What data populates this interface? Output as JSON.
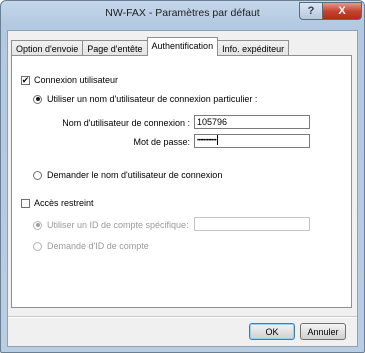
{
  "window": {
    "title": "NW-FAX - Paramètres par défaut"
  },
  "titlebar": {
    "help_glyph": "?",
    "close_glyph": "X"
  },
  "tabs": [
    {
      "label": "Option d'envoie",
      "active": false
    },
    {
      "label": "Page d'entête",
      "active": false
    },
    {
      "label": "Authentification",
      "active": true
    },
    {
      "label": "Info. expéditeur",
      "active": false
    }
  ],
  "auth": {
    "user_login": {
      "label": "Connexion utilisateur",
      "checked": true
    },
    "use_specific": {
      "label": "Utiliser un nom d'utilisateur de connexion particulier :",
      "selected": true
    },
    "username": {
      "label": "Nom d'utilisateur de connexion :",
      "value": "105796"
    },
    "password": {
      "label": "Mot de passe:",
      "value": "••••••••••••"
    },
    "ask_username": {
      "label": "Demander le nom d'utilisateur de connexion",
      "selected": false
    }
  },
  "restricted": {
    "label": "Accès restreint",
    "checked": false,
    "use_account_id": {
      "label": "Utiliser un ID de compte spécifique:",
      "selected": true,
      "enabled": false,
      "value": ""
    },
    "ask_account_id": {
      "label": "Demande d'ID de compte",
      "selected": false,
      "enabled": false
    }
  },
  "buttons": {
    "ok": "OK",
    "cancel": "Annuler"
  },
  "icons": {
    "check": "check-icon"
  }
}
